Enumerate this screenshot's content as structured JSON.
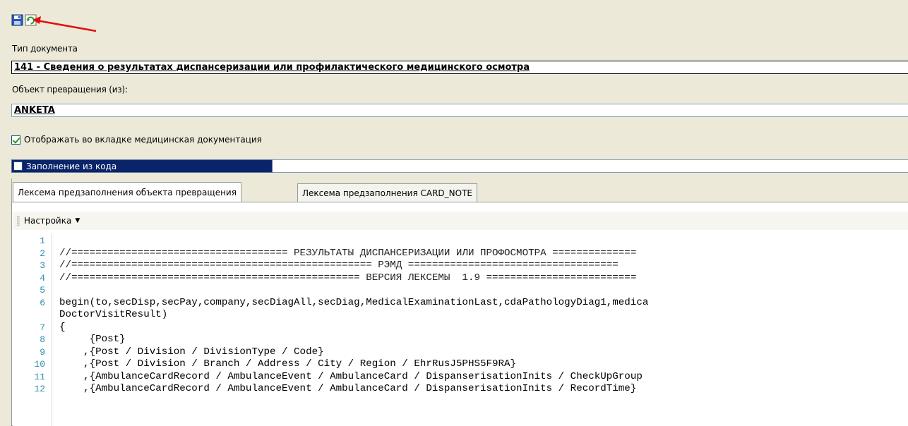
{
  "toolbar": {
    "save_icon": "save-icon",
    "refresh_icon": "refresh-icon"
  },
  "doc_type": {
    "label": "Тип документа",
    "value": "141 - Сведения о результатах диспансеризации или профилактического медицинского осмотра"
  },
  "object": {
    "label": "Объект превращения (из):",
    "value": "ANKETA"
  },
  "options": {
    "show_in_tab": {
      "label": "Отображать во вкладке медицинская документация",
      "checked": true
    },
    "fill_from_code": {
      "label": "Заполнение из кода",
      "checked": false
    }
  },
  "tabs": [
    {
      "label": "Лексема предзаполнения объекта превращения",
      "active": true
    },
    {
      "label": "Лексема предзаполнения CARD_NOTE",
      "active": false
    }
  ],
  "settings_menu": {
    "label": "Настройка"
  },
  "editor": {
    "lines": [
      {
        "n": "1",
        "text": ""
      },
      {
        "n": "2",
        "text": "//==================================== РЕЗУЛЬТАТЫ ДИСПАНСЕРИЗАЦИИ ИЛИ ПРОФОСМОТРА =============="
      },
      {
        "n": "3",
        "text": "//================================================== РЭМД ==================================="
      },
      {
        "n": "4",
        "text": "//================================================ ВЕРСИЯ ЛЕКСЕМЫ  1.9 ========================="
      },
      {
        "n": "5",
        "text": ""
      },
      {
        "n": "6",
        "text": "begin(to,secDisp,secPay,company,secDiagAll,secDiag,MedicalExaminationLast,cdaPathologyDiag1,medica"
      },
      {
        "n": "",
        "text": "DoctorVisitResult)"
      },
      {
        "n": "7",
        "text": "{"
      },
      {
        "n": "8",
        "text": "     {Post}"
      },
      {
        "n": "9",
        "text": "    ,{Post / Division / DivisionType / Code}"
      },
      {
        "n": "10",
        "text": "    ,{Post / Division / Branch / Address / City / Region / EhrRusJ5PHS5F9RA}"
      },
      {
        "n": "11",
        "text": "    ,{AmbulanceCardRecord / AmbulanceEvent / AmbulanceCard / DispanserisationInits / CheckUpGroup"
      },
      {
        "n": "12",
        "text": "    ,{AmbulanceCardRecord / AmbulanceEvent / AmbulanceCard / DispanserisationInits / RecordTime}"
      }
    ]
  }
}
